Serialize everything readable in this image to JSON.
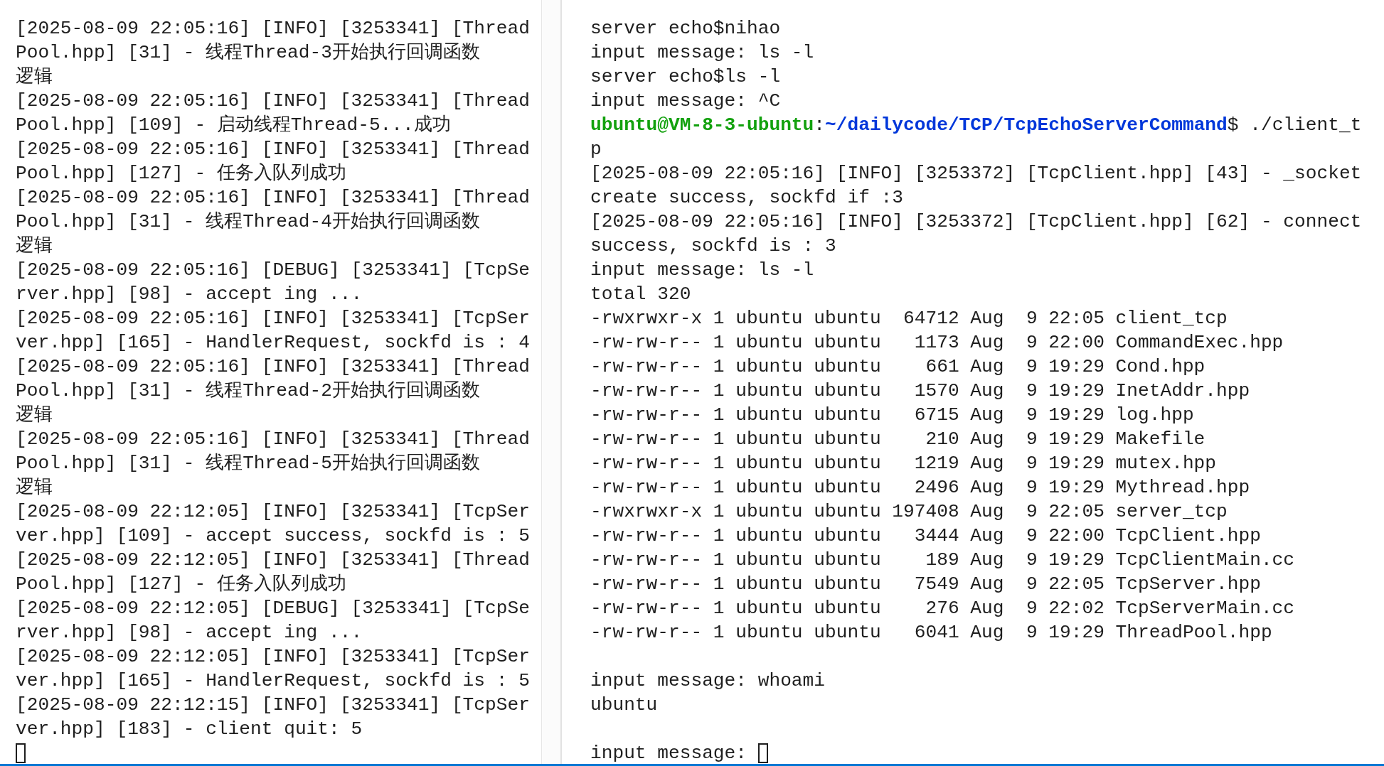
{
  "left_pane": {
    "lines": [
      {
        "kind": "text",
        "text": "[2025-08-09 22:05:16] [INFO] [3253341] [Thread"
      },
      {
        "kind": "text",
        "text": "Pool.hpp] [31] - 线程Thread-3开始执行回调函数"
      },
      {
        "kind": "text",
        "text": "逻辑"
      },
      {
        "kind": "text",
        "text": "[2025-08-09 22:05:16] [INFO] [3253341] [Thread"
      },
      {
        "kind": "text",
        "text": "Pool.hpp] [109] - 启动线程Thread-5...成功"
      },
      {
        "kind": "text",
        "text": "[2025-08-09 22:05:16] [INFO] [3253341] [Thread"
      },
      {
        "kind": "text",
        "text": "Pool.hpp] [127] - 任务入队列成功"
      },
      {
        "kind": "text",
        "text": "[2025-08-09 22:05:16] [INFO] [3253341] [Thread"
      },
      {
        "kind": "text",
        "text": "Pool.hpp] [31] - 线程Thread-4开始执行回调函数"
      },
      {
        "kind": "text",
        "text": "逻辑"
      },
      {
        "kind": "text",
        "text": "[2025-08-09 22:05:16] [DEBUG] [3253341] [TcpSe"
      },
      {
        "kind": "text",
        "text": "rver.hpp] [98] - accept ing ..."
      },
      {
        "kind": "text",
        "text": "[2025-08-09 22:05:16] [INFO] [3253341] [TcpSer"
      },
      {
        "kind": "text",
        "text": "ver.hpp] [165] - HandlerRequest, sockfd is : 4"
      },
      {
        "kind": "text",
        "text": "[2025-08-09 22:05:16] [INFO] [3253341] [Thread"
      },
      {
        "kind": "text",
        "text": "Pool.hpp] [31] - 线程Thread-2开始执行回调函数"
      },
      {
        "kind": "text",
        "text": "逻辑"
      },
      {
        "kind": "text",
        "text": "[2025-08-09 22:05:16] [INFO] [3253341] [Thread"
      },
      {
        "kind": "text",
        "text": "Pool.hpp] [31] - 线程Thread-5开始执行回调函数"
      },
      {
        "kind": "text",
        "text": "逻辑"
      },
      {
        "kind": "text",
        "text": "[2025-08-09 22:12:05] [INFO] [3253341] [TcpSer"
      },
      {
        "kind": "text",
        "text": "ver.hpp] [109] - accept success, sockfd is : 5"
      },
      {
        "kind": "text",
        "text": "[2025-08-09 22:12:05] [INFO] [3253341] [Thread"
      },
      {
        "kind": "text",
        "text": "Pool.hpp] [127] - 任务入队列成功"
      },
      {
        "kind": "text",
        "text": "[2025-08-09 22:12:05] [DEBUG] [3253341] [TcpSe"
      },
      {
        "kind": "text",
        "text": "rver.hpp] [98] - accept ing ..."
      },
      {
        "kind": "text",
        "text": "[2025-08-09 22:12:05] [INFO] [3253341] [TcpSer"
      },
      {
        "kind": "text",
        "text": "ver.hpp] [165] - HandlerRequest, sockfd is : 5"
      },
      {
        "kind": "text",
        "text": "[2025-08-09 22:12:15] [INFO] [3253341] [TcpSer"
      },
      {
        "kind": "text",
        "text": "ver.hpp] [183] - client quit: 5"
      },
      {
        "kind": "cursor"
      }
    ]
  },
  "right_pane": {
    "lines": [
      {
        "kind": "text",
        "text": "server echo$nihao"
      },
      {
        "kind": "text",
        "text": "input message: ls -l"
      },
      {
        "kind": "text",
        "text": "server echo$ls -l"
      },
      {
        "kind": "text",
        "text": "input message: ^C"
      },
      {
        "kind": "prompt",
        "user_host": "ubuntu@VM-8-3-ubuntu",
        "separator": ":",
        "path": "~/dailycode/TCP/TcpEchoServerCommand",
        "suffix": "$ ./client_t"
      },
      {
        "kind": "text",
        "text": "p"
      },
      {
        "kind": "text",
        "text": "[2025-08-09 22:05:16] [INFO] [3253372] [TcpClient.hpp] [43] - _socket"
      },
      {
        "kind": "text",
        "text": "create success, sockfd if :3"
      },
      {
        "kind": "text",
        "text": "[2025-08-09 22:05:16] [INFO] [3253372] [TcpClient.hpp] [62] - connect"
      },
      {
        "kind": "text",
        "text": "success, sockfd is : 3"
      },
      {
        "kind": "text",
        "text": "input message: ls -l"
      },
      {
        "kind": "text",
        "text": "total 320"
      },
      {
        "kind": "text",
        "text": "-rwxrwxr-x 1 ubuntu ubuntu  64712 Aug  9 22:05 client_tcp"
      },
      {
        "kind": "text",
        "text": "-rw-rw-r-- 1 ubuntu ubuntu   1173 Aug  9 22:00 CommandExec.hpp"
      },
      {
        "kind": "text",
        "text": "-rw-rw-r-- 1 ubuntu ubuntu    661 Aug  9 19:29 Cond.hpp"
      },
      {
        "kind": "text",
        "text": "-rw-rw-r-- 1 ubuntu ubuntu   1570 Aug  9 19:29 InetAddr.hpp"
      },
      {
        "kind": "text",
        "text": "-rw-rw-r-- 1 ubuntu ubuntu   6715 Aug  9 19:29 log.hpp"
      },
      {
        "kind": "text",
        "text": "-rw-rw-r-- 1 ubuntu ubuntu    210 Aug  9 19:29 Makefile"
      },
      {
        "kind": "text",
        "text": "-rw-rw-r-- 1 ubuntu ubuntu   1219 Aug  9 19:29 mutex.hpp"
      },
      {
        "kind": "text",
        "text": "-rw-rw-r-- 1 ubuntu ubuntu   2496 Aug  9 19:29 Mythread.hpp"
      },
      {
        "kind": "text",
        "text": "-rwxrwxr-x 1 ubuntu ubuntu 197408 Aug  9 22:05 server_tcp"
      },
      {
        "kind": "text",
        "text": "-rw-rw-r-- 1 ubuntu ubuntu   3444 Aug  9 22:00 TcpClient.hpp"
      },
      {
        "kind": "text",
        "text": "-rw-rw-r-- 1 ubuntu ubuntu    189 Aug  9 19:29 TcpClientMain.cc"
      },
      {
        "kind": "text",
        "text": "-rw-rw-r-- 1 ubuntu ubuntu   7549 Aug  9 22:05 TcpServer.hpp"
      },
      {
        "kind": "text",
        "text": "-rw-rw-r-- 1 ubuntu ubuntu    276 Aug  9 22:02 TcpServerMain.cc"
      },
      {
        "kind": "text",
        "text": "-rw-rw-r-- 1 ubuntu ubuntu   6041 Aug  9 19:29 ThreadPool.hpp"
      },
      {
        "kind": "blank"
      },
      {
        "kind": "text",
        "text": "input message: whoami"
      },
      {
        "kind": "text",
        "text": "ubuntu"
      },
      {
        "kind": "blank"
      },
      {
        "kind": "input",
        "text": "input message: "
      }
    ]
  }
}
